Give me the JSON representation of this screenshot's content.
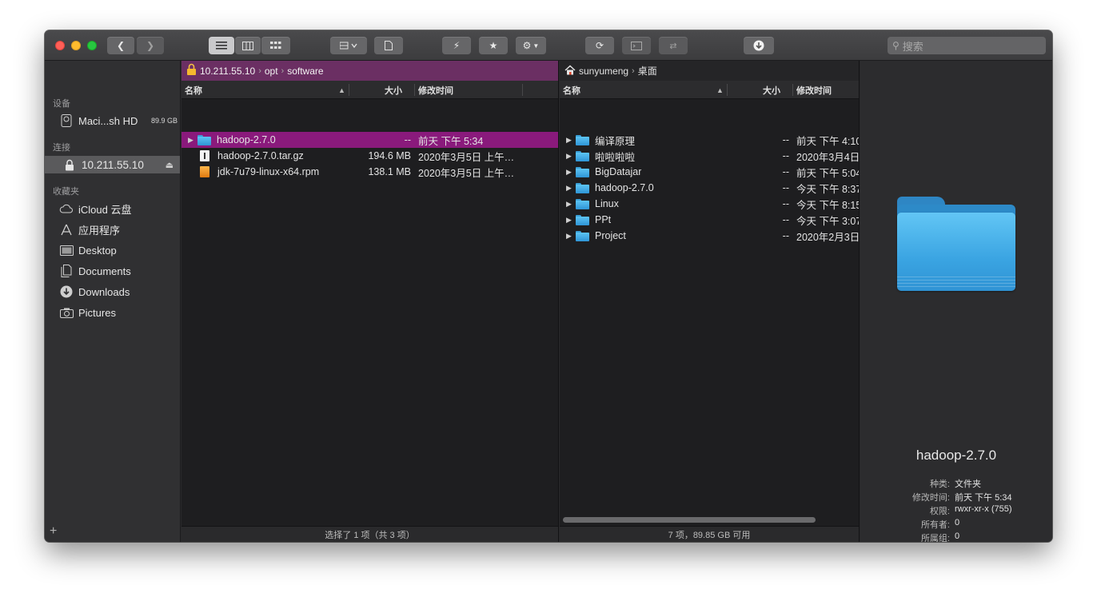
{
  "toolbar": {
    "search_placeholder": "搜索"
  },
  "sidebar": {
    "sections": {
      "devices": "设备",
      "connections": "连接",
      "favorites": "收藏夹"
    },
    "device": {
      "label": "Maci...sh HD",
      "badge": "89.9 GB"
    },
    "connection": {
      "label": "10.211.55.10"
    },
    "favorites": [
      {
        "label": "iCloud 云盘",
        "icon": "cloud-icon"
      },
      {
        "label": "应用程序",
        "icon": "applications-icon"
      },
      {
        "label": "Desktop",
        "icon": "desktop-icon"
      },
      {
        "label": "Documents",
        "icon": "documents-icon"
      },
      {
        "label": "Downloads",
        "icon": "downloads-icon"
      },
      {
        "label": "Pictures",
        "icon": "camera-icon"
      }
    ]
  },
  "left_pane": {
    "path": [
      "10.211.55.10",
      "opt",
      "software"
    ],
    "columns": {
      "name": "名称",
      "size": "大小",
      "modified": "修改时间"
    },
    "rows": [
      {
        "name": "hadoop-2.7.0",
        "size": "--",
        "modified": "前天 下午 5:34",
        "kind": "folder",
        "selected": true
      },
      {
        "name": "hadoop-2.7.0.tar.gz",
        "size": "194.6 MB",
        "modified": "2020年3月5日 上午…",
        "kind": "file"
      },
      {
        "name": "jdk-7u79-linux-x64.rpm",
        "size": "138.1 MB",
        "modified": "2020年3月5日 上午…",
        "kind": "rpm"
      }
    ],
    "status": "选择了 1 项（共 3 项）"
  },
  "right_pane": {
    "path": [
      "sunyumeng",
      "桌面"
    ],
    "columns": {
      "name": "名称",
      "size": "大小",
      "modified": "修改时间"
    },
    "rows": [
      {
        "name": "编译原理",
        "size": "--",
        "modified": "前天 下午 4:10"
      },
      {
        "name": "啦啦啦啦",
        "size": "--",
        "modified": "2020年3月4日"
      },
      {
        "name": "BigDatajar",
        "size": "--",
        "modified": "前天 下午 5:04"
      },
      {
        "name": "hadoop-2.7.0",
        "size": "--",
        "modified": "今天 下午 8:37"
      },
      {
        "name": "Linux",
        "size": "--",
        "modified": "今天 下午 8:15"
      },
      {
        "name": "PPt",
        "size": "--",
        "modified": "今天 下午 3:07"
      },
      {
        "name": "Project",
        "size": "--",
        "modified": "2020年2月3日"
      }
    ],
    "status": "7 项，89.85 GB 可用"
  },
  "preview": {
    "title": "hadoop-2.7.0",
    "meta": [
      {
        "key": "种类:",
        "value": "文件夹"
      },
      {
        "key": "修改时间:",
        "value": "前天 下午 5:34"
      },
      {
        "key": "权限:",
        "value": "rwxr-xr-x (755)"
      },
      {
        "key": "所有者:",
        "value": "0"
      },
      {
        "key": "所属组:",
        "value": "0"
      }
    ]
  },
  "colors": {
    "selection": "#8a1a7c",
    "remote_path_bar": "#6b2f63",
    "folder_blue": "#3aa4e2"
  }
}
